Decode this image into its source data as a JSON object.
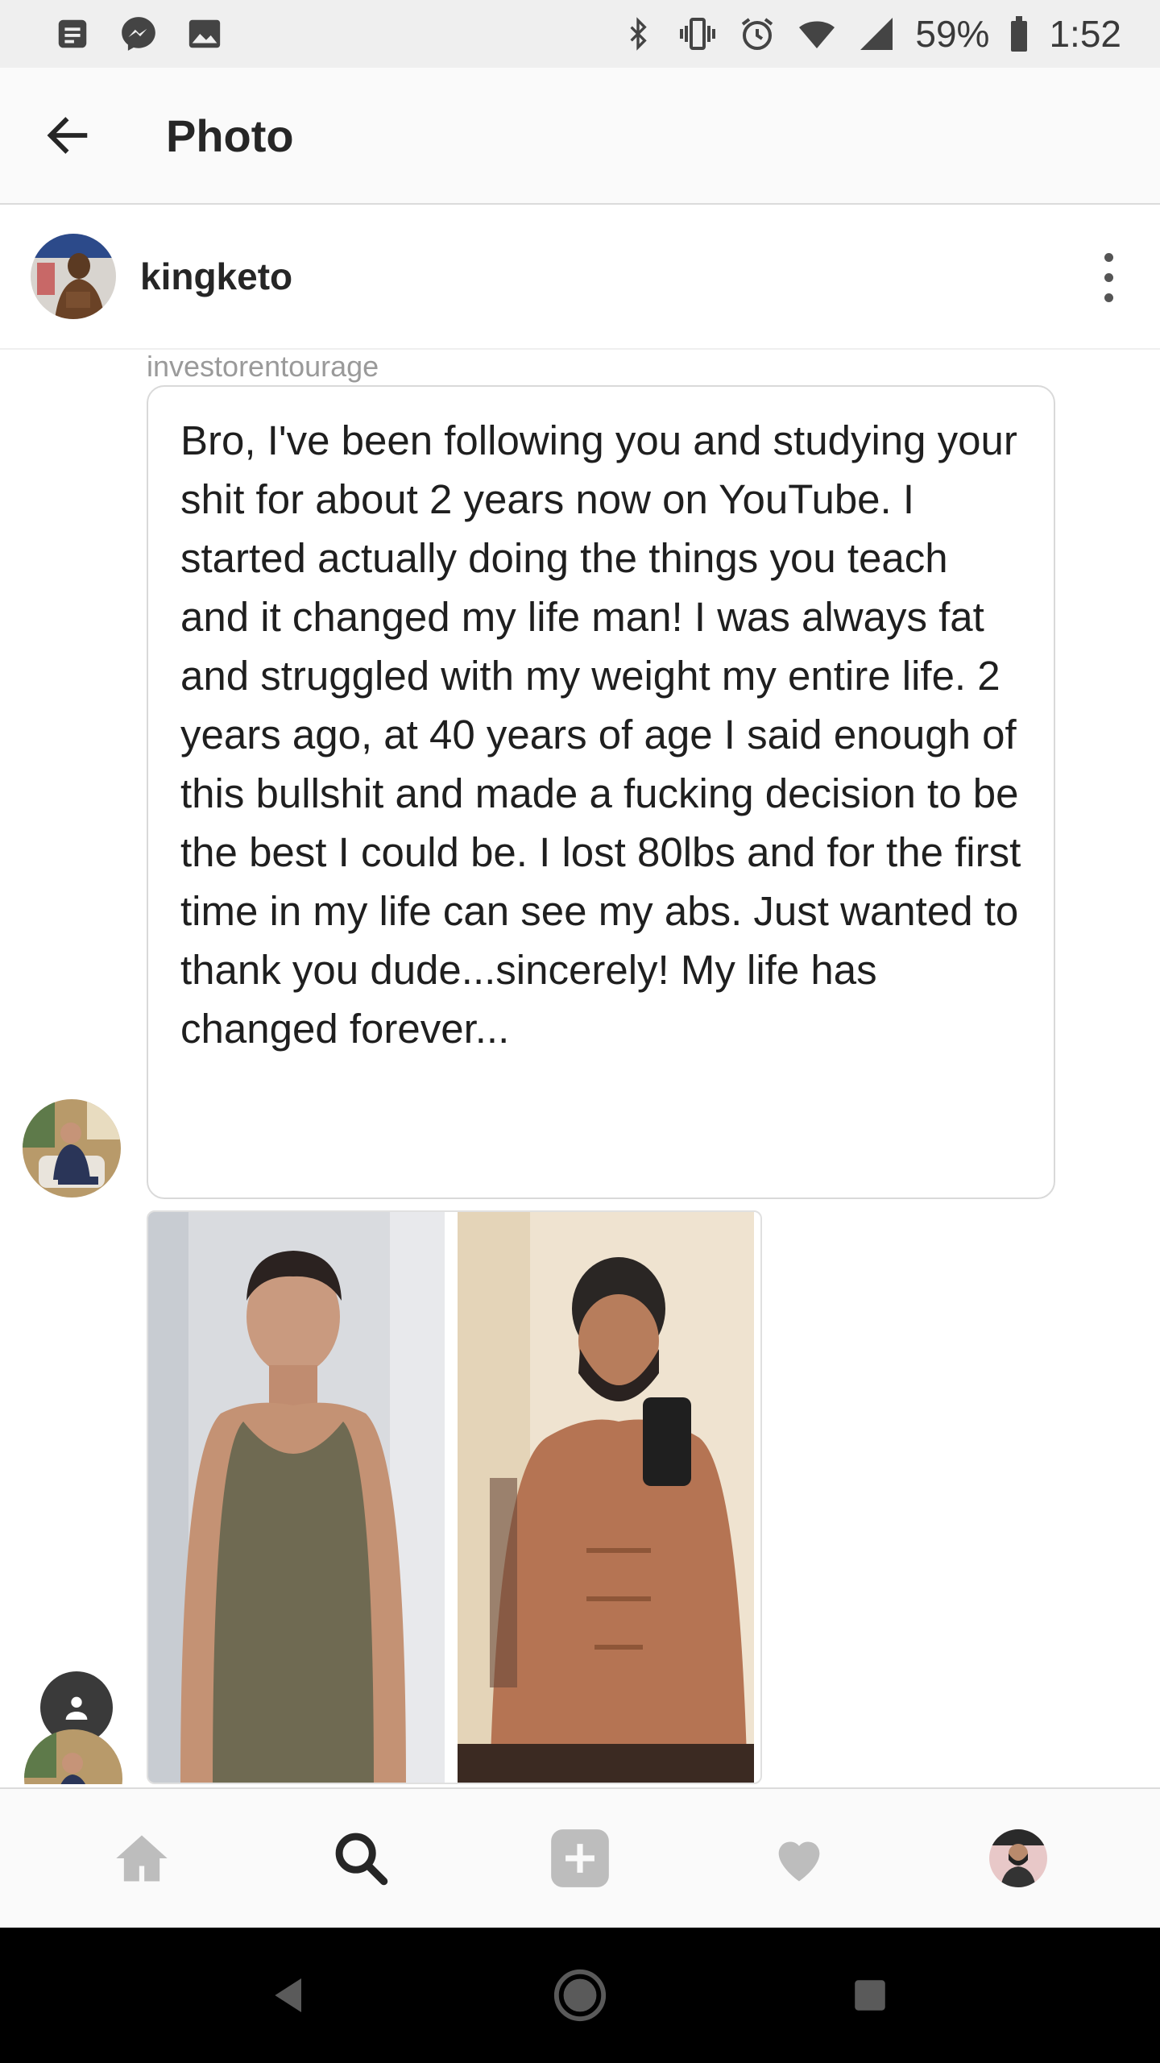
{
  "status_bar": {
    "battery_percent": "59%",
    "time": "1:52",
    "icons": [
      "notes-icon",
      "messenger-icon",
      "gallery-icon",
      "bluetooth-icon",
      "vibrate-icon",
      "alarm-icon",
      "wifi-icon",
      "signal-icon",
      "battery-icon"
    ]
  },
  "app_bar": {
    "title": "Photo",
    "back_icon": "arrow-left-icon"
  },
  "post": {
    "username": "kingketo",
    "more_icon": "more-vertical-icon"
  },
  "message": {
    "sender": "investorentourage",
    "text": "Bro, I've been following you and studying your shit for about 2 years now on YouTube.  I started actually doing the things you teach and it changed my life man!  I was always fat and struggled with my weight my entire life.  2 years ago, at 40 years of age I said enough of this bullshit and made a fucking decision to be the best I could be.  I lost 80lbs and for the first time in my life can see my abs.  Just wanted to thank you dude...sincerely!  My life has changed forever..."
  },
  "bottom_nav": {
    "items": [
      "home-icon",
      "search-icon",
      "add-post-icon",
      "heart-icon",
      "profile-avatar"
    ]
  },
  "system_nav": {
    "items": [
      "back-triangle-icon",
      "home-circle-icon",
      "recents-square-icon"
    ]
  },
  "colors": {
    "status_bar_bg": "#efefef",
    "app_bar_bg": "#fafafa",
    "text_primary": "#262626",
    "text_secondary": "#9a9a9a",
    "divider": "#dbdbdb"
  }
}
